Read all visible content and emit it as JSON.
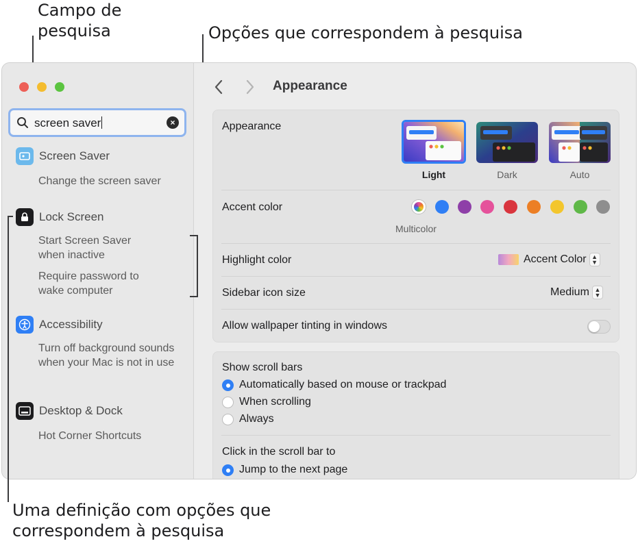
{
  "callouts": {
    "search_field": [
      "Campo de",
      "pesquisa"
    ],
    "matching_options": "Opções que correspondem à pesquisa",
    "setting_with_options": [
      "Uma definição com opções que",
      "correspondem à pesquisa"
    ]
  },
  "search": {
    "value": "screen saver"
  },
  "sidebar": {
    "results": [
      {
        "label": "Screen Saver",
        "icon": "screen-saver-icon",
        "options": [
          "Change the screen saver"
        ]
      },
      {
        "label": "Lock Screen",
        "icon": "lock-icon",
        "options": [
          "Start Screen Saver when inactive",
          "Require password to wake computer"
        ]
      },
      {
        "label": "Accessibility",
        "icon": "accessibility-icon",
        "options": [
          "Turn off background sounds when your Mac is not in use"
        ]
      },
      {
        "label": "Desktop & Dock",
        "icon": "desktop-dock-icon",
        "options": [
          "Hot Corner Shortcuts"
        ]
      }
    ]
  },
  "toolbar": {
    "back_icon": "chevron-left-icon",
    "forward_icon": "chevron-right-icon",
    "title": "Appearance"
  },
  "appearance_card": {
    "appearance": {
      "label": "Appearance",
      "options": [
        "Light",
        "Dark",
        "Auto"
      ],
      "selected": "Light"
    },
    "accent_color": {
      "label": "Accent color",
      "multicolor_label": "Multicolor",
      "colors": [
        "multicolor",
        "#2f7ff5",
        "#8e3fa8",
        "#e5529b",
        "#d9353e",
        "#ec7f25",
        "#f3c62d",
        "#5fb848",
        "#8e8e8e"
      ]
    },
    "highlight_color": {
      "label": "Highlight color",
      "value": "Accent Color"
    },
    "sidebar_icon_size": {
      "label": "Sidebar icon size",
      "value": "Medium"
    },
    "wallpaper_tinting": {
      "label": "Allow wallpaper tinting in windows",
      "enabled": false
    }
  },
  "scroll_card": {
    "show_scroll_bars": {
      "label": "Show scroll bars",
      "options": [
        "Automatically based on mouse or trackpad",
        "When scrolling",
        "Always"
      ],
      "selected": "Automatically based on mouse or trackpad"
    },
    "click_scroll_bar": {
      "label": "Click in the scroll bar to",
      "options": [
        "Jump to the next page"
      ],
      "selected": "Jump to the next page"
    }
  }
}
